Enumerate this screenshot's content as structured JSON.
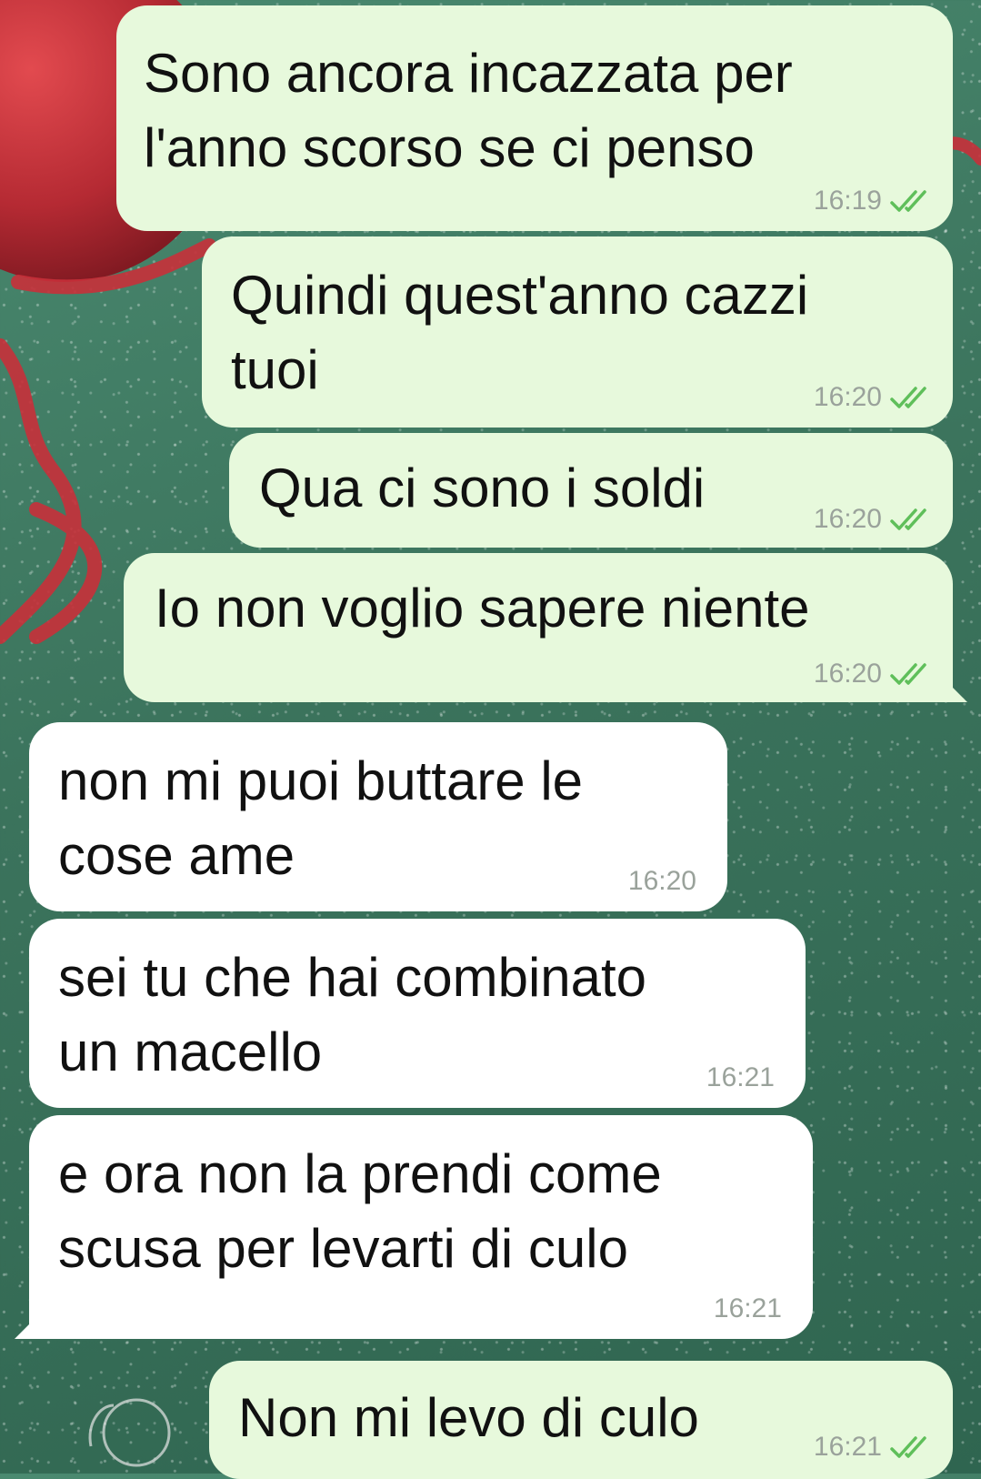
{
  "messages": [
    {
      "direction": "out",
      "text": "Sono ancora incazzata per\nl'anno scorso se ci penso",
      "time": "16:19",
      "status_icon": "double-check-icon"
    },
    {
      "direction": "out",
      "text": "Quindi quest'anno cazzi\ntuoi",
      "time": "16:20",
      "status_icon": "double-check-icon"
    },
    {
      "direction": "out",
      "text": "Qua ci sono i soldi",
      "time": "16:20",
      "status_icon": "double-check-icon"
    },
    {
      "direction": "out",
      "text": "Io non voglio sapere niente",
      "time": "16:20",
      "status_icon": "double-check-icon"
    },
    {
      "direction": "in",
      "text": "non mi puoi buttare le\ncose ame",
      "time": "16:20"
    },
    {
      "direction": "in",
      "text": "sei tu che hai combinato\nun macello",
      "time": "16:21"
    },
    {
      "direction": "in",
      "text": "e ora non la prendi come\nscusa per levarti di culo",
      "time": "16:21"
    },
    {
      "direction": "out",
      "text": "Non mi levo di culo",
      "time": "16:21",
      "status_icon": "double-check-icon"
    }
  ],
  "colors": {
    "outgoing_bubble": "#e7f9dc",
    "incoming_bubble": "#ffffff",
    "read_ticks": "#5fbf5a",
    "time_text": "#9aa29b",
    "wallpaper_green": "#3f7a62",
    "ornament_red": "#c8303a"
  }
}
